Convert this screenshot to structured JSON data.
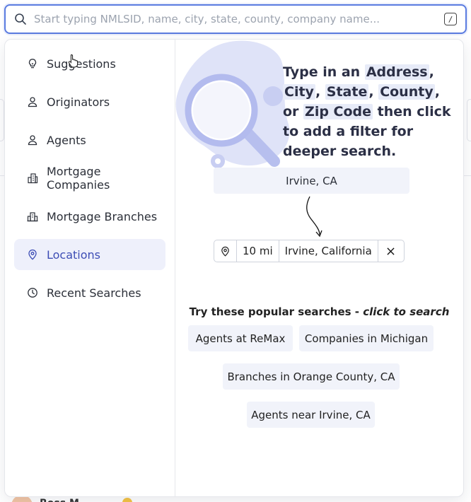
{
  "search": {
    "placeholder": "Start typing NMLSID, name, city, state, county, company name...",
    "value": "",
    "shortcut": "/"
  },
  "sidebar": {
    "items": [
      {
        "label": "Suggestions",
        "icon": "lightbulb-icon",
        "active": false
      },
      {
        "label": "Originators",
        "icon": "user-icon",
        "active": false
      },
      {
        "label": "Agents",
        "icon": "user-icon",
        "active": false
      },
      {
        "label": "Mortgage Companies",
        "icon": "building-icon",
        "active": false
      },
      {
        "label": "Mortgage Branches",
        "icon": "branch-building-icon",
        "active": false
      },
      {
        "label": "Locations",
        "icon": "location-pin-icon",
        "active": true
      },
      {
        "label": "Recent Searches",
        "icon": "clock-icon",
        "active": false
      }
    ]
  },
  "hint": {
    "t1": "Type in an ",
    "h1": "Address",
    "t2": ", ",
    "h2": "City",
    "t3": ", ",
    "h3": "State",
    "t4": ", ",
    "h4": "County",
    "t5": ", or ",
    "h5": "Zip Code",
    "t6": " then click to add a filter for deeper search."
  },
  "example": {
    "input_chip": "Irvine, CA",
    "filter_radius": "10 mi",
    "filter_location": "Irvine, California",
    "filter_icon": "location-pin-icon",
    "remove_icon": "close-icon"
  },
  "popular": {
    "title": "Try these popular searches - ",
    "title_em": "click to search",
    "items": [
      "Agents at ReMax",
      "Companies in Michigan",
      "Branches in Orange County, CA",
      "Agents near Irvine, CA"
    ]
  },
  "colors": {
    "accent": "#5a7be0",
    "active_bg": "#eef0fb",
    "active_text": "#3d4db5",
    "chip_bg": "#f1f3fa",
    "illustration": "#d6dbf6"
  }
}
